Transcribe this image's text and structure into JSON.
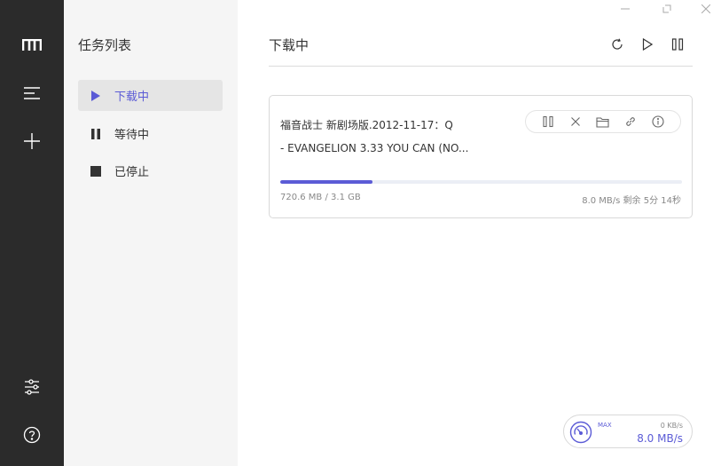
{
  "rail": {
    "logo": "logo-icon",
    "items": [
      "menu-icon",
      "add-icon"
    ],
    "bottom": [
      "preferences-icon",
      "help-icon"
    ]
  },
  "sidebar": {
    "title": "任务列表",
    "items": [
      {
        "label": "下载中",
        "icon": "play-icon",
        "active": true
      },
      {
        "label": "等待中",
        "icon": "pause-icon",
        "active": false
      },
      {
        "label": "已停止",
        "icon": "stop-icon",
        "active": false
      }
    ]
  },
  "main": {
    "title": "下载中",
    "actions": [
      "refresh-icon",
      "resume-all-icon",
      "pause-all-icon"
    ]
  },
  "task": {
    "name_line1": "福音战士 新剧场版.2012-11-17：Q",
    "name_line2": "- EVANGELION 3.33 YOU CAN (NO...",
    "progress_fraction": 0.23,
    "size": "720.6 MB / 3.1 GB",
    "speed": "8.0 MB/s 剩余 5分 14秒",
    "actions": [
      "pause-icon",
      "delete-icon",
      "folder-icon",
      "link-icon",
      "info-icon"
    ]
  },
  "speedometer": {
    "max_label": "MAX",
    "upload": "0 KB/s",
    "download": "8.0 MB/s"
  },
  "colors": {
    "accent": "#5b5bd6",
    "rail_bg": "#2b2b2b",
    "sidebar_bg": "#f5f5f5"
  }
}
